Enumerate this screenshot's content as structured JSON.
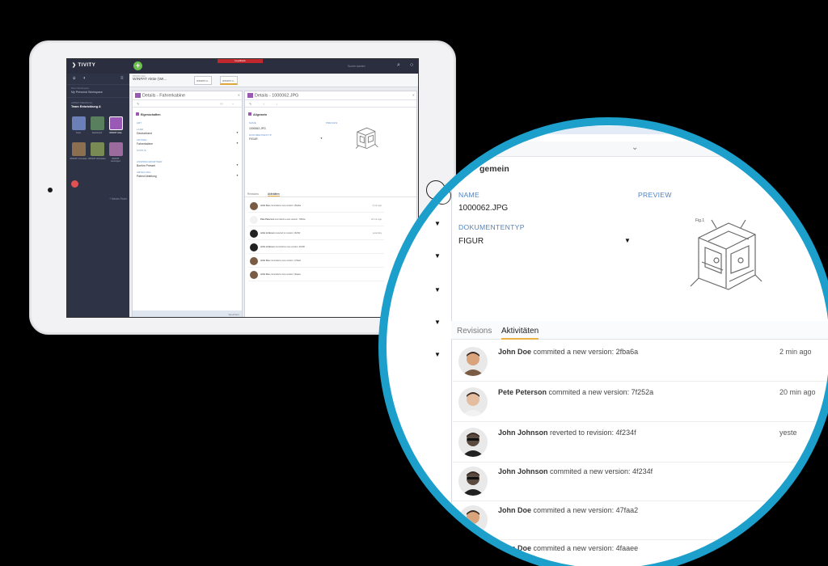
{
  "app": {
    "logo": "TIVITY",
    "red_tab": "Feedback",
    "search_placeholder": "Suche starten"
  },
  "sidebar": {
    "workspace_label": "Mein Workspace",
    "workspace_name": "My Personal Workspace",
    "team_label": "ARBEITSBEREICH",
    "team_name": "Team Entwicklung A",
    "tiles": [
      {
        "label": "Team",
        "color": "#6b7fb8"
      },
      {
        "label": "Dashboard",
        "color": "#59805e"
      },
      {
        "label": "WINPAT Aktie",
        "color": "#9b59b6"
      },
      {
        "label": "WINPAT Formulare",
        "color": "#8b6f4e"
      },
      {
        "label": "WINPAT Workplace",
        "color": "#7a8a54"
      },
      {
        "label": "WINPAT Leistungen",
        "color": "#9c6a9c"
      }
    ],
    "add_team": "Neues Team"
  },
  "workspace": {
    "main_tab": "WINPAT Aktie (WI...",
    "main_tab_sub": "WINPAT Aktie",
    "tabs": [
      "WINPAT A...",
      "WINPAT A..."
    ]
  },
  "left_panel": {
    "title": "Details - Fahrerkabine",
    "section": "Eigenschaften",
    "fields": [
      {
        "label": "ART",
        "value": ""
      },
      {
        "label": "LAND",
        "value": "Deutschland"
      },
      {
        "label": "ARTIKEL",
        "value": "Fahrerkabine"
      },
      {
        "label": "STATUS",
        "value": ""
      },
      {
        "label": "ANSPRECHPARTNER",
        "value": "Boehm Pressel"
      },
      {
        "label": "ABTEILUNG",
        "value": "Patent Abteilung"
      }
    ],
    "footer": "Speichern"
  },
  "mini_panel": {
    "title": "Details - 1000062.JPG",
    "section": "Allgemein",
    "name_label": "NAME",
    "name_value": "1000062.JPG",
    "preview_label": "PREVIEW",
    "type_label": "DOKUMENTENTYP",
    "type_value": "FIGUR",
    "tabs": [
      "Revisions",
      "Aktivitäten"
    ]
  },
  "zoom": {
    "section_title": "gemein",
    "name_label": "NAME",
    "name_value": "1000062.JPG",
    "preview_label": "PREVIEW",
    "type_label": "DOKUMENTENTYP",
    "type_value": "FIGUR",
    "tabs": [
      "Revisions",
      "Aktivitäten"
    ],
    "activities": [
      {
        "who": "John Doe",
        "action": "commited a new version: 2fba6a",
        "time": "2 min ago"
      },
      {
        "who": "Pete Peterson",
        "action": "commited a new version: 7f252a",
        "time": "20 min ago"
      },
      {
        "who": "John Johnson",
        "action": "reverted to revision: 4f234f",
        "time": "yeste"
      },
      {
        "who": "John Johnson",
        "action": "commited a new version: 4f234f",
        "time": ""
      },
      {
        "who": "John Doe",
        "action": "commited a new version: 47faa2",
        "time": ""
      },
      {
        "who": "John Doe",
        "action": "commited a new version: 4faaee",
        "time": ""
      }
    ],
    "mini_activities": [
      {
        "who": "John Doe",
        "action": "commited a new version: 2fba6a",
        "time": "2 min ago"
      },
      {
        "who": "Pete Peterson",
        "action": "commited a new version: 7f252a",
        "time": "20 min ago"
      },
      {
        "who": "John Johnson",
        "action": "reverted to revision: 4f234f",
        "time": "yesterday"
      },
      {
        "who": "John Johnson",
        "action": "commited a new version: 4f234f",
        "time": ""
      },
      {
        "who": "John Doe",
        "action": "commited a new version: 47faa2",
        "time": ""
      },
      {
        "who": "John Doe",
        "action": "commited a new version: 4faaee",
        "time": ""
      }
    ]
  },
  "colors": {
    "accent": "#1d9fcb",
    "tab_underline": "#e8b141",
    "label_blue": "#4f84c4",
    "sidebar": "#2f3346"
  }
}
